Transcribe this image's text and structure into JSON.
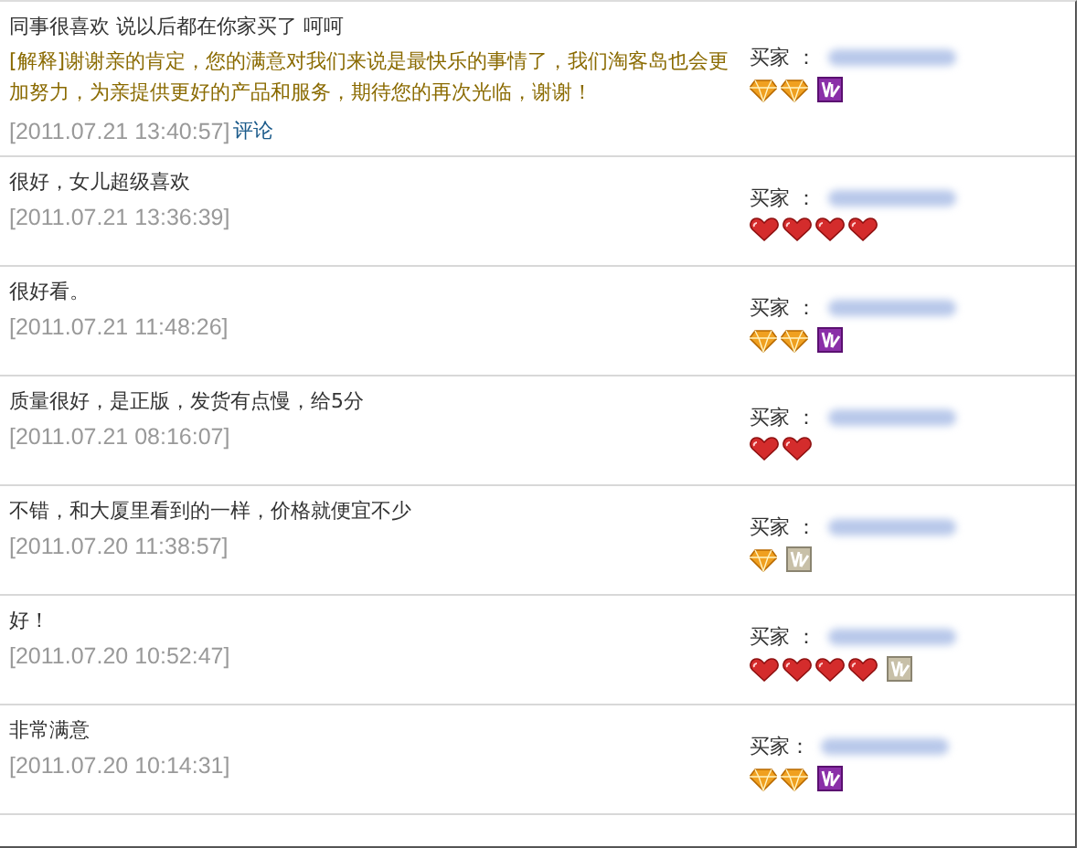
{
  "reviews": [
    {
      "comment": "同事很喜欢 说以后都在你家买了 呵呵",
      "reply": "[解释]谢谢亲的肯定，您的满意对我们来说是最快乐的事情了，我们淘客岛也会更加努力，为亲提供更好的产品和服务，期待您的再次光临，谢谢！",
      "time": "[2011.07.21 13:40:57]",
      "link": "评论",
      "buyer_label": "买家 ：",
      "badges": [
        {
          "kind": "diamond"
        },
        {
          "kind": "diamond"
        },
        {
          "kind": "vip"
        }
      ]
    },
    {
      "comment": "很好，女儿超级喜欢",
      "time": "[2011.07.21 13:36:39]",
      "buyer_label": "买家 ：",
      "badges": [
        {
          "kind": "heart"
        },
        {
          "kind": "heart"
        },
        {
          "kind": "heart"
        },
        {
          "kind": "heart"
        }
      ]
    },
    {
      "comment": "很好看。",
      "time": "[2011.07.21 11:48:26]",
      "buyer_label": "买家 ：",
      "badges": [
        {
          "kind": "diamond"
        },
        {
          "kind": "diamond"
        },
        {
          "kind": "vip"
        }
      ]
    },
    {
      "comment": "质量很好，是正版，发货有点慢，给5分",
      "time": "[2011.07.21 08:16:07]",
      "buyer_label": "买家 ：",
      "badges": [
        {
          "kind": "heart"
        },
        {
          "kind": "heart"
        }
      ]
    },
    {
      "comment": "不错，和大厦里看到的一样，价格就便宜不少",
      "time": "[2011.07.20 11:38:57]",
      "buyer_label": "买家 ：",
      "badges": [
        {
          "kind": "diamond"
        },
        {
          "kind": "vipoff"
        }
      ]
    },
    {
      "comment": "好！",
      "time": "[2011.07.20 10:52:47]",
      "buyer_label": "买家 ：",
      "badges": [
        {
          "kind": "heart"
        },
        {
          "kind": "heart"
        },
        {
          "kind": "heart"
        },
        {
          "kind": "heart"
        },
        {
          "kind": "vipoff"
        }
      ]
    },
    {
      "comment": "非常满意",
      "time": "[2011.07.20 10:14:31]",
      "buyer_label": "买家：",
      "badges": [
        {
          "kind": "diamond"
        },
        {
          "kind": "diamond"
        },
        {
          "kind": "vip"
        }
      ]
    }
  ]
}
